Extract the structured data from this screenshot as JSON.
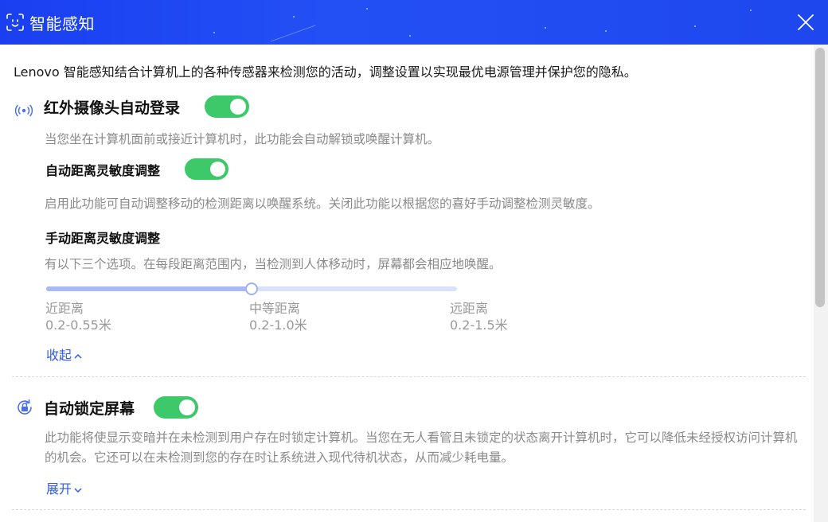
{
  "window": {
    "title": "智能感知",
    "title_icon": "face-scan-icon",
    "close_icon": "close-icon"
  },
  "intro": "Lenovo 智能感知结合计算机上的各种传感器来检测您的活动，调整设置以实现最优电源管理并保护您的隐私。",
  "sections": [
    {
      "icon": "wireless-signal-icon",
      "title": "红外摄像头自动登录",
      "enabled": true,
      "description": "当您坐在计算机面前或接近计算机时，此功能会自动解锁或唤醒计算机。",
      "auto_distance": {
        "title": "自动距离灵敏度调整",
        "enabled": true,
        "description": "启用此功能可自动调整移动的检测距离以唤醒系统。关闭此功能以根据您的喜好手动调整检测灵敏度。"
      },
      "manual_distance": {
        "title": "手动距离灵敏度调整",
        "description": "有以下三个选项。在每段距离范围内，当检测到人体移动时，屏幕都会相应地唤醒。",
        "selected_index": 1,
        "options": [
          {
            "name": "近距离",
            "range": "0.2-0.55米"
          },
          {
            "name": "中等距离",
            "range": "0.2-1.0米"
          },
          {
            "name": "远距离",
            "range": "0.2-1.5米"
          }
        ]
      },
      "toggle_link": "收起"
    },
    {
      "icon": "lock-refresh-icon",
      "title": "自动锁定屏幕",
      "enabled": true,
      "description": "此功能将使显示变暗并在未检测到用户存在时锁定计算机。当您在无人看管且未锁定的状态离开计算机时，它可以降低未经授权访问计算机的机会。它还可以在未检测到您的存在时让系统进入现代待机状态，从而减少耗电量。",
      "toggle_link": "展开"
    }
  ],
  "colors": {
    "titlebar": "#1e48ee",
    "toggle_on": "#3dc96a",
    "link": "#2c5be8",
    "slider": "#a8b9f5"
  }
}
